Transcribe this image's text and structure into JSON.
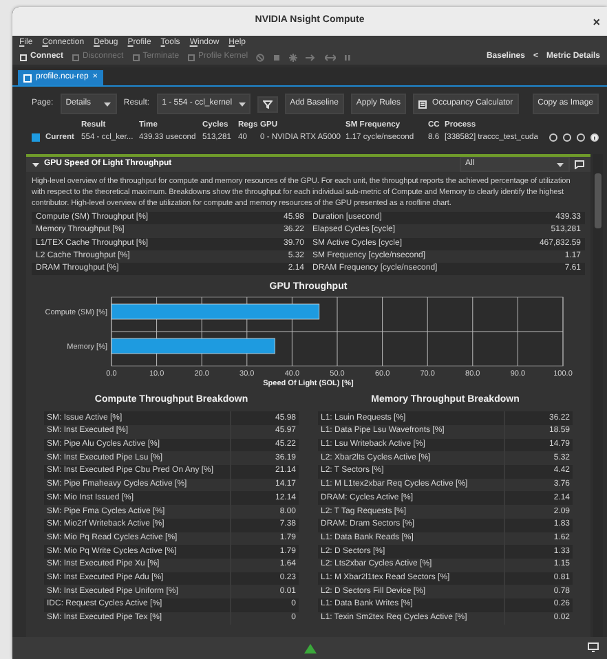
{
  "window": {
    "title": "NVIDIA Nsight Compute",
    "close": "×"
  },
  "menu": [
    "File",
    "Connection",
    "Debug",
    "Profile",
    "Tools",
    "Window",
    "Help"
  ],
  "toolbar": [
    {
      "label": "Connect",
      "disabled": false
    },
    {
      "label": "Disconnect",
      "disabled": true
    },
    {
      "label": "Terminate",
      "disabled": true
    },
    {
      "label": "Profile Kernel",
      "disabled": true
    }
  ],
  "toolbar_right": [
    "Baselines",
    "<",
    "Metric Details"
  ],
  "tab": {
    "label": "profile.ncu-rep",
    "close": "×",
    "selected": true
  },
  "controls": {
    "page_label": "Page:",
    "page_value": "Details",
    "result_label": "Result:",
    "result_value": "1 - 554 - ccl_kernel",
    "buttons": [
      "Add Baseline",
      "Apply Rules",
      "Occupancy Calculator"
    ],
    "copy": "Copy as Image"
  },
  "result_table": {
    "columns": [
      "Result",
      "Time",
      "Cycles",
      "Regs",
      "GPU",
      "SM Frequency",
      "CC",
      "Process"
    ],
    "row": {
      "label": "Current",
      "cells": [
        "554 - ccl_ker...",
        "439.33 usecond",
        "513,281",
        "40",
        "0 - NVIDIA RTX A5000",
        "1.17 cycle/nsecond",
        "8.6",
        "[338582] traccc_test_cuda"
      ]
    }
  },
  "section": {
    "title": "GPU Speed Of Light Throughput",
    "expanded": true,
    "filter": "All",
    "description": "High-level overview of the throughput for compute and memory resources of the GPU. For each unit, the throughput reports the achieved percentage of utilization with respect to the theoretical maximum. Breakdowns show the throughput for each individual sub-metric of Compute and Memory to clearly identify the highest contributor. High-level overview of the utilization for compute and memory resources of the GPU presented as a roofline chart.",
    "metrics": [
      {
        "left_name": "Compute (SM) Throughput [%]",
        "left_value": "45.98",
        "right_name": "Duration [usecond]",
        "right_value": "439.33"
      },
      {
        "left_name": "Memory Throughput [%]",
        "left_value": "36.22",
        "right_name": "Elapsed Cycles [cycle]",
        "right_value": "513,281"
      },
      {
        "left_name": "L1/TEX Cache Throughput [%]",
        "left_value": "39.70",
        "right_name": "SM Active Cycles [cycle]",
        "right_value": "467,832.59"
      },
      {
        "left_name": "L2 Cache Throughput [%]",
        "left_value": "5.32",
        "right_name": "SM Frequency [cycle/nsecond]",
        "right_value": "1.17"
      },
      {
        "left_name": "DRAM Throughput [%]",
        "left_value": "2.14",
        "right_name": "DRAM Frequency [cycle/nsecond]",
        "right_value": "7.61"
      }
    ],
    "chart_data": {
      "type": "bar",
      "orientation": "horizontal",
      "title": "GPU Throughput",
      "xlabel": "Speed Of Light (SOL) [%]",
      "categories": [
        "Compute (SM) [%]",
        "Memory [%]"
      ],
      "series": [
        {
          "color": "#1e9be0",
          "values": [
            46.0,
            36.2
          ]
        }
      ],
      "grid": true,
      "xlim": [
        0,
        100
      ],
      "xticks": [
        {
          "value": 0,
          "label": "0.0"
        },
        {
          "value": 10,
          "label": "10.0"
        },
        {
          "value": 20,
          "label": "20.0"
        },
        {
          "value": 30,
          "label": "30.0"
        },
        {
          "value": 40,
          "label": "40.0"
        },
        {
          "value": 50,
          "label": "50.0"
        },
        {
          "value": 60,
          "label": "60.0"
        },
        {
          "value": 70,
          "label": "70.0"
        },
        {
          "value": 80,
          "label": "80.0"
        },
        {
          "value": 90,
          "label": "90.0"
        },
        {
          "value": 100,
          "label": "100.0"
        }
      ]
    },
    "breakdowns": [
      {
        "title": "Compute Throughput Breakdown",
        "rows": [
          [
            "SM: Issue Active [%]",
            "45.98"
          ],
          [
            "SM: Inst Executed [%]",
            "45.97"
          ],
          [
            "SM: Pipe Alu Cycles Active [%]",
            "45.22"
          ],
          [
            "SM: Inst Executed Pipe Lsu [%]",
            "36.19"
          ],
          [
            "SM: Inst Executed Pipe Cbu Pred On Any [%]",
            "21.14"
          ],
          [
            "SM: Pipe Fmaheavy Cycles Active [%]",
            "14.17"
          ],
          [
            "SM: Mio Inst Issued [%]",
            "12.14"
          ],
          [
            "SM: Pipe Fma Cycles Active [%]",
            "8.00"
          ],
          [
            "SM: Mio2rf Writeback Active [%]",
            "7.38"
          ],
          [
            "SM: Mio Pq Read Cycles Active [%]",
            "1.79"
          ],
          [
            "SM: Mio Pq Write Cycles Active [%]",
            "1.79"
          ],
          [
            "SM: Inst Executed Pipe Xu [%]",
            "1.64"
          ],
          [
            "SM: Inst Executed Pipe Adu [%]",
            "0.23"
          ],
          [
            "SM: Inst Executed Pipe Uniform [%]",
            "0.01"
          ],
          [
            "IDC: Request Cycles Active [%]",
            "0"
          ],
          [
            "SM: Inst Executed Pipe Tex [%]",
            "0"
          ]
        ]
      },
      {
        "title": "Memory Throughput Breakdown",
        "rows": [
          [
            "L1: Lsuin Requests [%]",
            "36.22"
          ],
          [
            "L1: Data Pipe Lsu Wavefronts [%]",
            "18.59"
          ],
          [
            "L1: Lsu Writeback Active [%]",
            "14.79"
          ],
          [
            "L2: Xbar2lts Cycles Active [%]",
            "5.32"
          ],
          [
            "L2: T Sectors [%]",
            "4.42"
          ],
          [
            "L1: M L1tex2xbar Req Cycles Active [%]",
            "3.76"
          ],
          [
            "DRAM: Cycles Active [%]",
            "2.14"
          ],
          [
            "L2: T Tag Requests [%]",
            "2.09"
          ],
          [
            "DRAM: Dram Sectors [%]",
            "1.83"
          ],
          [
            "L1: Data Bank Reads [%]",
            "1.62"
          ],
          [
            "L2: D Sectors [%]",
            "1.33"
          ],
          [
            "L2: Lts2xbar Cycles Active [%]",
            "1.15"
          ],
          [
            "L1: M Xbar2l1tex Read Sectors [%]",
            "0.81"
          ],
          [
            "L2: D Sectors Fill Device [%]",
            "0.78"
          ],
          [
            "L1: Data Bank Writes [%]",
            "0.26"
          ],
          [
            "L1: Texin Sm2tex Req Cycles Active [%]",
            "0.02"
          ]
        ]
      }
    ]
  }
}
